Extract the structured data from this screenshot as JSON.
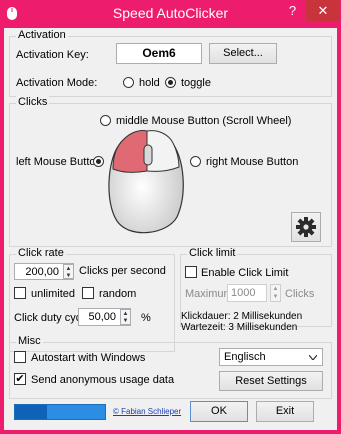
{
  "window": {
    "title": "Speed AutoClicker",
    "help_glyph": "?",
    "close_glyph": "✕",
    "accent": "#ed1c6c"
  },
  "activation": {
    "legend": "Activation",
    "key_label": "Activation Key:",
    "key_value": "Oem6",
    "select_button": "Select...",
    "mode_label": "Activation Mode:",
    "mode_hold": "hold",
    "mode_toggle": "toggle",
    "selected_mode": "toggle"
  },
  "clicks": {
    "legend": "Clicks",
    "middle_label": "middle Mouse Button (Scroll Wheel)",
    "left_label": "left Mouse Button",
    "right_label": "right Mouse Button",
    "selected_button": "left",
    "settings_icon": "gear-icon"
  },
  "click_rate": {
    "legend": "Click rate",
    "rate_value": "200,00",
    "rate_unit": "Clicks per second",
    "unlimited_label": "unlimited",
    "random_label": "random",
    "duty_label": "Click duty cycle",
    "duty_value": "50,00",
    "duty_unit": "%"
  },
  "click_limit": {
    "legend": "Click limit",
    "enable_label": "Enable Click Limit",
    "maximum_label": "Maximum",
    "maximum_value": "1000",
    "maximum_unit": "Clicks",
    "info_line1": "Klickdauer: 2 Millisekunden",
    "info_line2": "Wartezeit: 3 Millisekunden"
  },
  "misc": {
    "legend": "Misc",
    "autostart_label": "Autostart with Windows",
    "anonymous_label": "Send anonymous usage data",
    "anonymous_checked": "✔",
    "language_value": "Englisch",
    "reset_button": "Reset Settings"
  },
  "footer": {
    "author_link": "© Fabian Schlieper",
    "ok_button": "OK",
    "exit_button": "Exit",
    "progress_fraction": 0.35,
    "progress_color": "#0f62b8"
  }
}
